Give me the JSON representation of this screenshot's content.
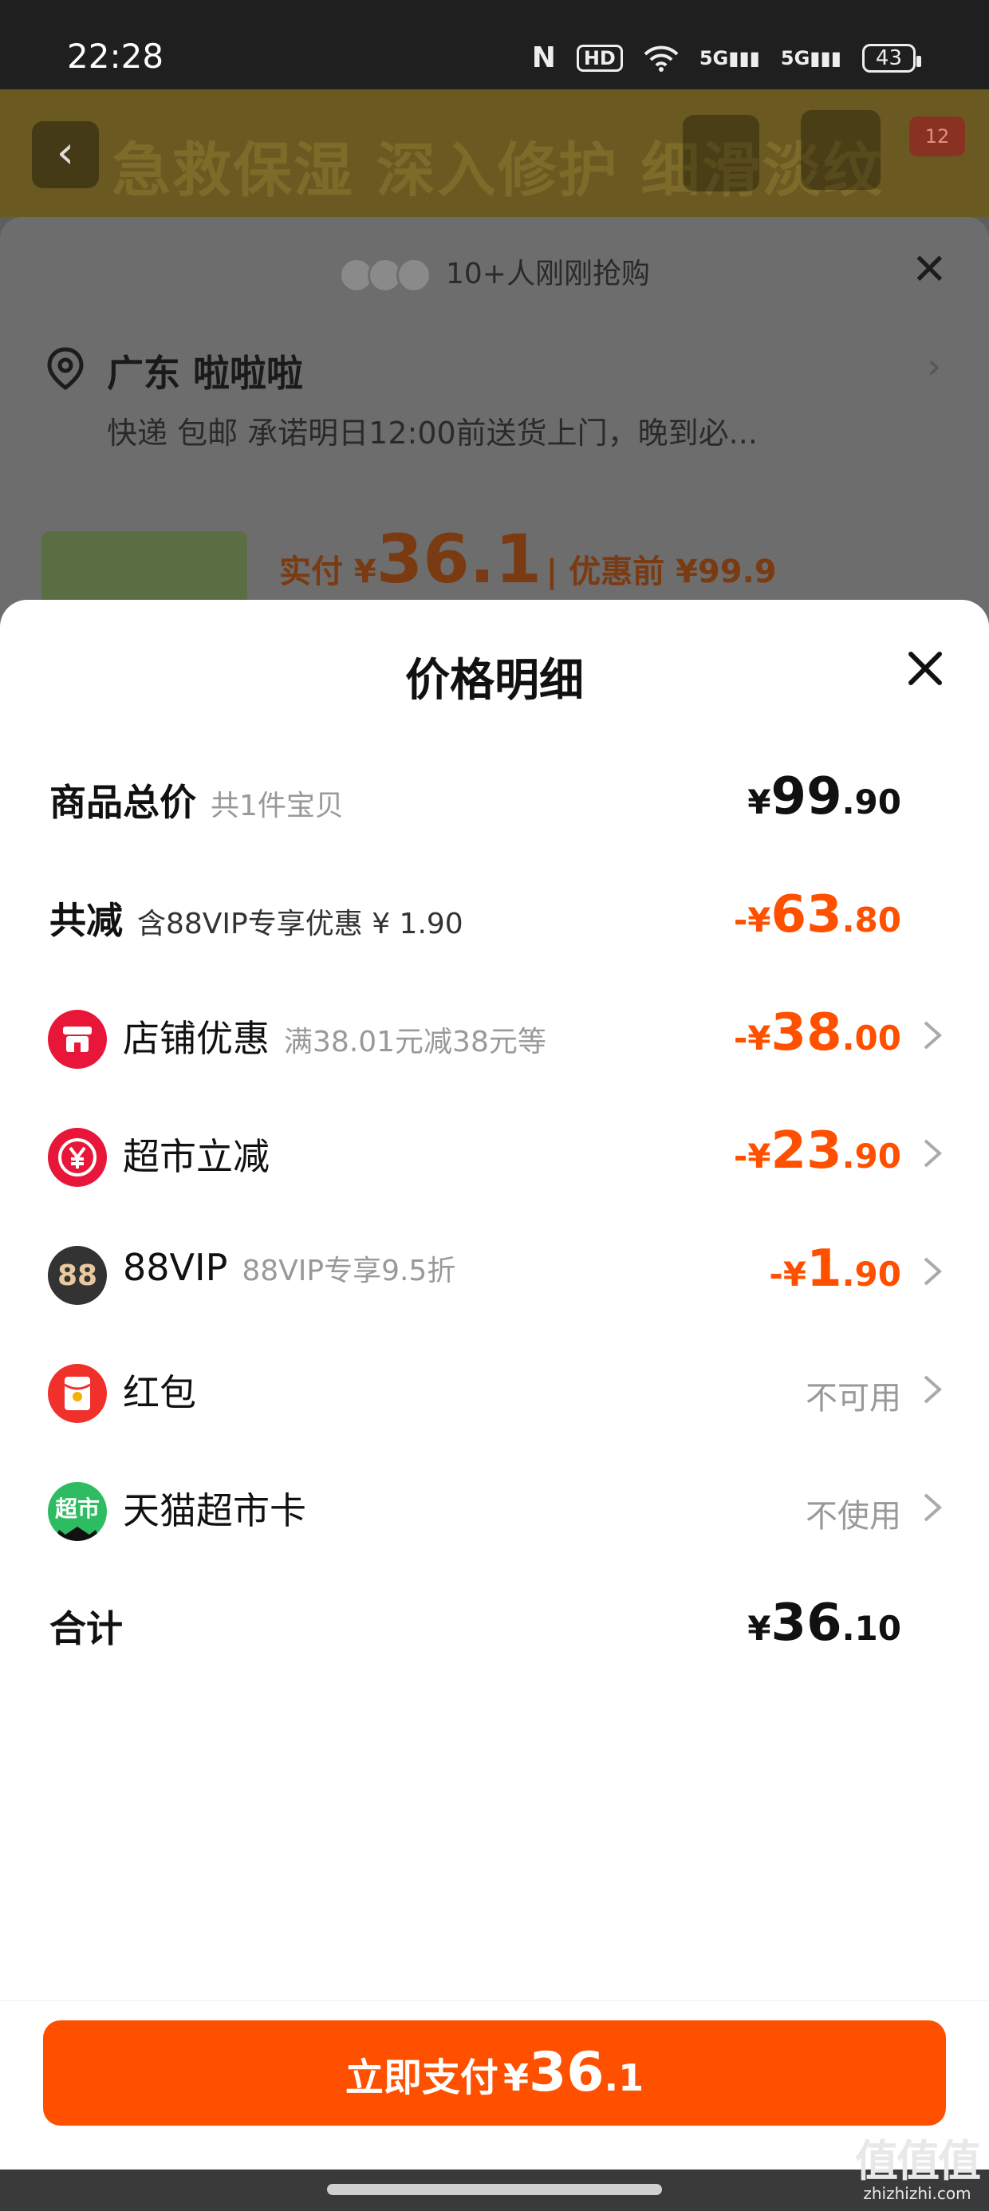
{
  "status_bar": {
    "time": "22:28",
    "nfc": "N",
    "hd": "HD",
    "net1": "5G",
    "net2": "5G",
    "battery": "43"
  },
  "background": {
    "banner_text": "急救保湿 深入修护 细滑淡纹",
    "badge": "12",
    "buyers_text": "10+人刚刚抢购",
    "address_title": "广东 啦啦啦",
    "address_line": "快递 包邮 承诺明日12:00前送货上门，晚到必...",
    "price_prefix": "实付 ¥",
    "price_value": "36.1",
    "price_before": "| 优惠前 ¥99.9"
  },
  "sheet": {
    "title": "价格明细",
    "total_row": {
      "label": "商品总价",
      "sub": "共1件宝贝",
      "sign": "¥",
      "int": "99",
      "dec": ".90"
    },
    "discount_row": {
      "label": "共减",
      "sub": "含88VIP专享优惠 ¥ 1.90",
      "sign": "-¥",
      "int": "63",
      "dec": ".80"
    },
    "items": [
      {
        "icon": "shop-icon",
        "label": "店铺优惠",
        "sub": "满38.01元减38元等",
        "sign": "-¥",
        "int": "38",
        "dec": ".00"
      },
      {
        "icon": "yuan-icon",
        "label": "超市立减",
        "sub": "",
        "sign": "-¥",
        "int": "23",
        "dec": ".90"
      },
      {
        "icon": "vip88-icon",
        "icon_text": "88",
        "label": "88VIP",
        "sub": "88VIP专享9.5折",
        "sign": "-¥",
        "int": "1",
        "dec": ".90"
      },
      {
        "icon": "red-packet-icon",
        "label": "红包",
        "status": "不可用"
      },
      {
        "icon": "tmall-card-icon",
        "icon_text": "超市",
        "label": "天猫超市卡",
        "status": "不使用"
      }
    ],
    "sum_row": {
      "label": "合计",
      "sign": "¥",
      "int": "36",
      "dec": ".10"
    }
  },
  "pay_button": {
    "label": "立即支付",
    "sign": "¥",
    "int": "36",
    "dec": ".1"
  },
  "watermark": {
    "mark": "值值值",
    "domain": "zhizhizhi.com"
  },
  "colors": {
    "accent": "#ff5000",
    "shop_red": "#e8173a",
    "packet_red": "#f0302a",
    "tmall_green": "#2ebc62",
    "vip_dark": "#333333"
  }
}
